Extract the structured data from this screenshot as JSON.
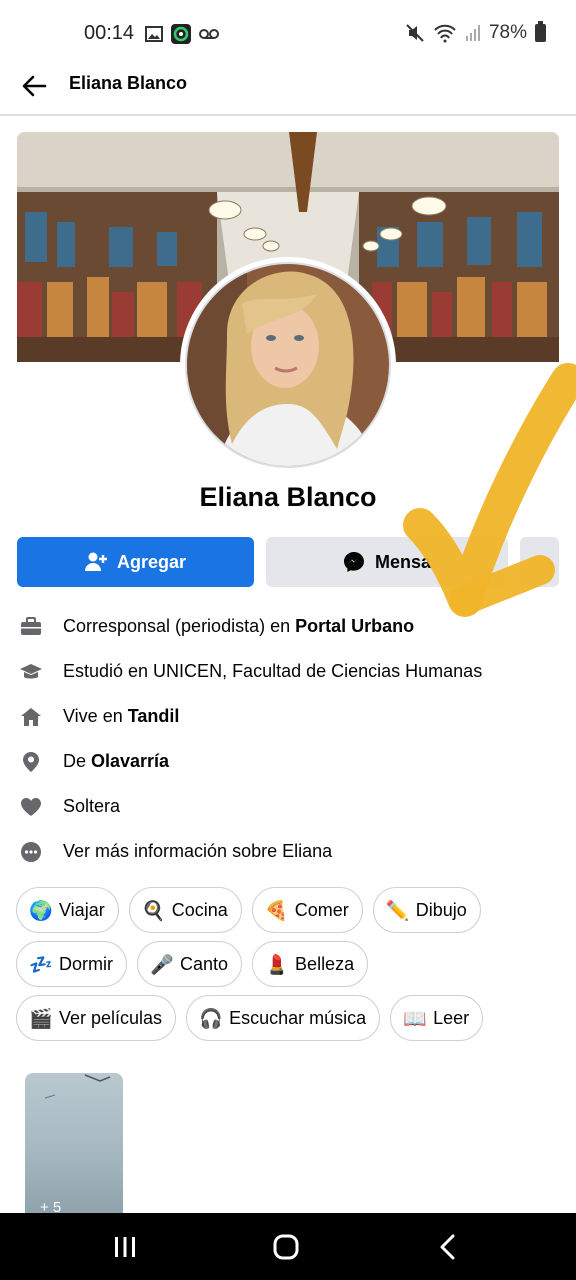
{
  "status_bar": {
    "time": "00:14",
    "battery": "78%",
    "icons": [
      "image-icon",
      "circle-app-icon",
      "voicemail-icon",
      "mute-icon",
      "wifi-icon",
      "signal-icon",
      "battery-icon"
    ]
  },
  "header": {
    "title": "Eliana Blanco"
  },
  "profile": {
    "name": "Eliana Blanco"
  },
  "actions": {
    "add_label": "Agregar",
    "message_label": "Mensa"
  },
  "info": {
    "work_prefix": "Corresponsal (periodista) en ",
    "work_place": "Portal Urbano",
    "education": "Estudió en UNICEN, Facultad de Ciencias Humanas",
    "lives_prefix": "Vive en ",
    "lives_city": "Tandil",
    "from_prefix": "De ",
    "from_city": "Olavarría",
    "relationship": "Soltera",
    "more_info": "Ver más información sobre Eliana"
  },
  "hobbies": [
    {
      "label": "Viajar",
      "emoji": "🌍"
    },
    {
      "label": "Cocina",
      "emoji": "🍳"
    },
    {
      "label": "Comer",
      "emoji": "🍕"
    },
    {
      "label": "Dibujo",
      "emoji": "✏️"
    },
    {
      "label": "Dormir",
      "emoji": "💤"
    },
    {
      "label": "Canto",
      "emoji": "🎤"
    },
    {
      "label": "Belleza",
      "emoji": "💄"
    },
    {
      "label": "Ver películas",
      "emoji": "🎬"
    },
    {
      "label": "Escuchar música",
      "emoji": "🎧"
    },
    {
      "label": "Leer",
      "emoji": "📖"
    }
  ],
  "photos": {
    "count_label": "+ 5"
  },
  "colors": {
    "primary": "#1b74e4",
    "secondary_button": "#e4e6eb",
    "checkmark": "#f0b429"
  }
}
